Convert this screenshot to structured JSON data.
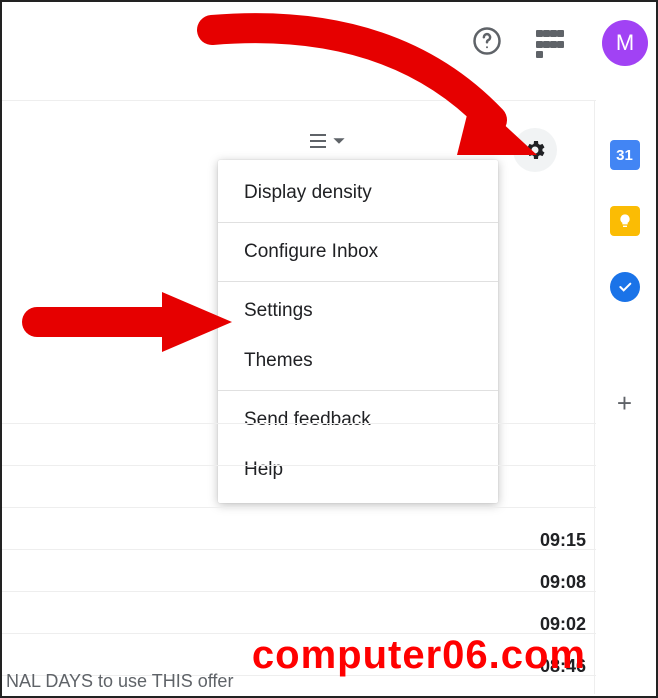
{
  "header": {
    "avatar_letter": "M"
  },
  "sidepanel": {
    "calendar_day": "31"
  },
  "menu": {
    "items": {
      "display_density": "Display density",
      "configure_inbox": "Configure Inbox",
      "settings": "Settings",
      "themes": "Themes",
      "send_feedback": "Send feedback",
      "help": "Help"
    }
  },
  "times": {
    "t1": "09:15",
    "t2": "09:08",
    "t3": "09:02",
    "t4": "08:46"
  },
  "partial_row_text": "NAL DAYS to use THIS offer",
  "watermark": "computer06.com"
}
